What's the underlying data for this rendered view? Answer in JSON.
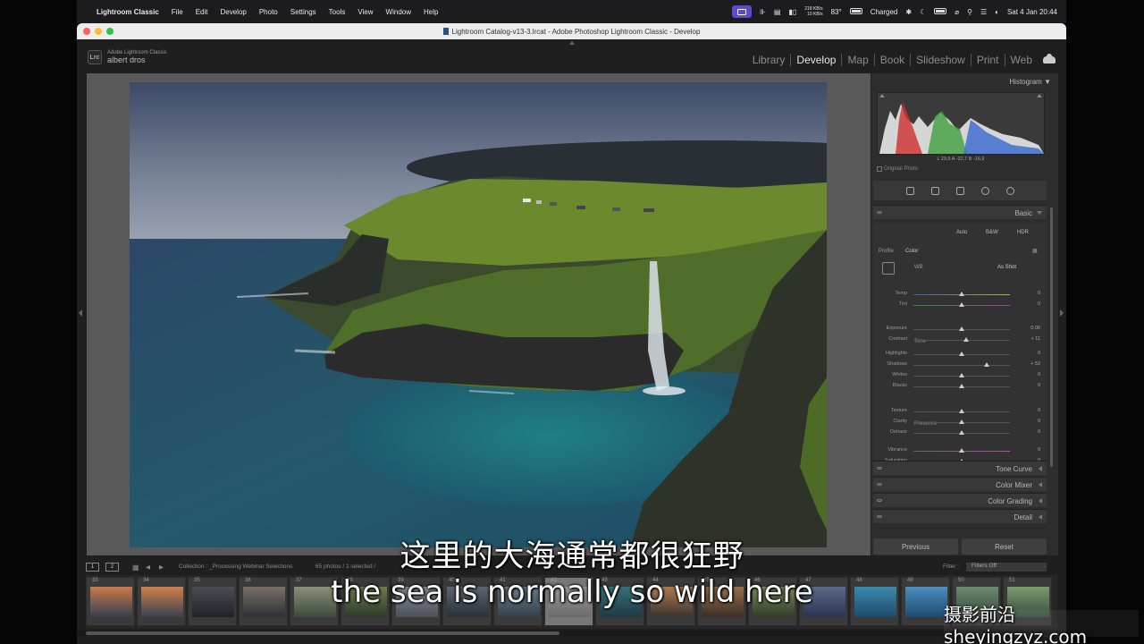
{
  "menubar": {
    "app": "Lightroom Classic",
    "items": [
      "File",
      "Edit",
      "Develop",
      "Photo",
      "Settings",
      "Tools",
      "View",
      "Window",
      "Help"
    ],
    "net_up": "218 KB/s",
    "net_down": "10 KB/s",
    "temp": "83°",
    "battery_status": "Charged",
    "clock": "Sat 4 Jan  20:44"
  },
  "window": {
    "title": "Lightroom Catalog-v13-3.lrcat - Adobe Photoshop Lightroom Classic - Develop"
  },
  "identity": {
    "logo": "Lrc",
    "line1": "Adobe Lightroom Classic",
    "line2": "albert dros"
  },
  "modules": [
    "Library",
    "Develop",
    "Map",
    "Book",
    "Slideshow",
    "Print",
    "Web"
  ],
  "active_module": "Develop",
  "panel": {
    "histogram_title": "Histogram",
    "hist_values": "L  29,5  A  -22,7  B  -16,9",
    "original_photo": "Original Photo",
    "basic_title": "Basic",
    "treatment": {
      "auto": "Auto",
      "bw": "B&W",
      "hdr": "HDR"
    },
    "profile_label": "Profile",
    "profile_value": "Color",
    "wb_label": "WB",
    "wb_value": "As Shot",
    "tone_title": "Tone",
    "presence_title": "Presence",
    "sliders": [
      {
        "label": "Temp",
        "value": "0",
        "pos": 0.5
      },
      {
        "label": "Tint",
        "value": "0",
        "pos": 0.5
      },
      {
        "label": "Exposure",
        "value": "0,00",
        "pos": 0.5
      },
      {
        "label": "Contrast",
        "value": "+ 11",
        "pos": 0.55
      },
      {
        "label": "Highlights",
        "value": "0",
        "pos": 0.5
      },
      {
        "label": "Shadows",
        "value": "+ 52",
        "pos": 0.76
      },
      {
        "label": "Whites",
        "value": "0",
        "pos": 0.5
      },
      {
        "label": "Blacks",
        "value": "0",
        "pos": 0.5
      },
      {
        "label": "Texture",
        "value": "0",
        "pos": 0.5
      },
      {
        "label": "Clarity",
        "value": "0",
        "pos": 0.5
      },
      {
        "label": "Dehaze",
        "value": "0",
        "pos": 0.5
      },
      {
        "label": "Vibrance",
        "value": "0",
        "pos": 0.5
      },
      {
        "label": "Saturation",
        "value": "0",
        "pos": 0.5
      }
    ],
    "sections": [
      "Tone Curve",
      "Color Mixer",
      "Color Grading",
      "Detail"
    ],
    "previous": "Previous",
    "reset": "Reset"
  },
  "filmstrip_bar": {
    "box1": "1",
    "box2": "2",
    "collection": "Collection : _Processing Webinar Selections",
    "count": "65 photos / 1 selected /",
    "filter_label": "Filter :",
    "filter_value": "Filters Off"
  },
  "filmstrip": {
    "numbers": [
      "33",
      "34",
      "35",
      "36",
      "37",
      "38",
      "39",
      "40",
      "41",
      "42",
      "43",
      "44",
      "45",
      "46",
      "47",
      "48",
      "49",
      "50",
      "51"
    ],
    "selected_index": 9
  },
  "subtitles": {
    "cn": "这里的大海通常都很狂野",
    "en": "the sea is normally so wild here"
  },
  "watermark": "摄影前沿sheyingzyz.com"
}
